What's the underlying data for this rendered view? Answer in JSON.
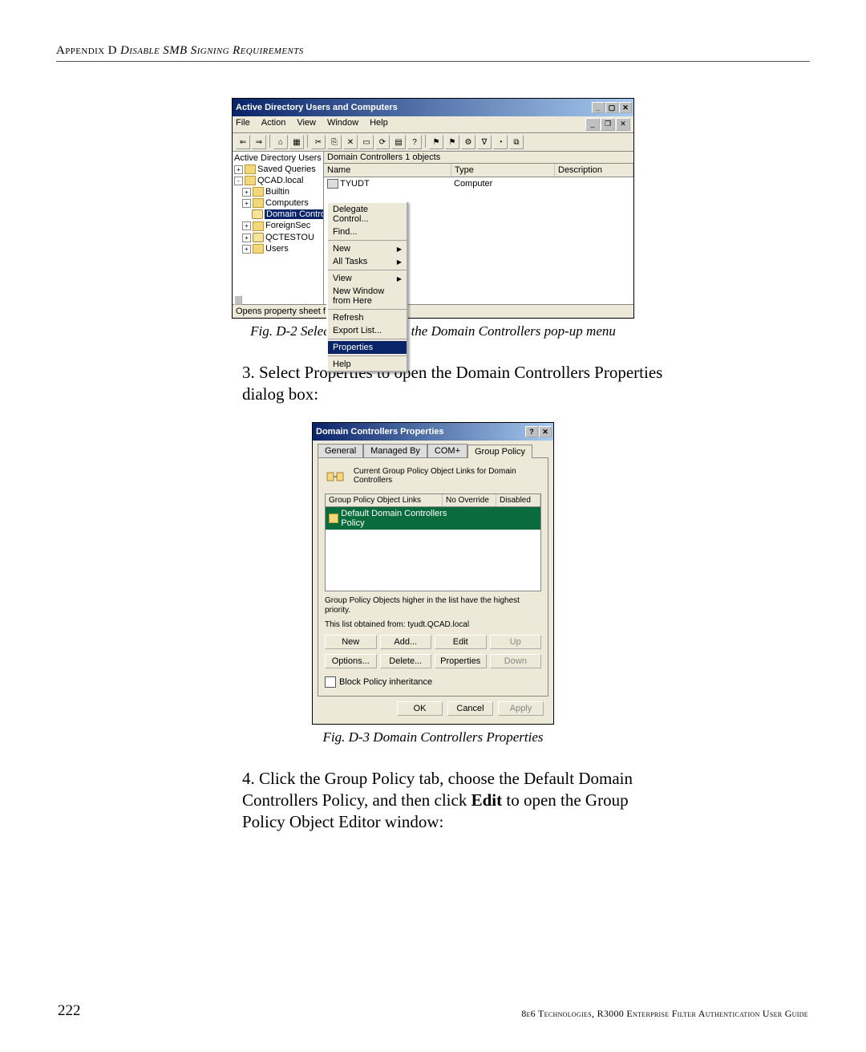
{
  "header": {
    "appendix": "Appendix D",
    "sep": "   ",
    "title_italic": "Disable SMB Signing Requirements"
  },
  "fig1": {
    "window_title": "Active Directory Users and Computers",
    "menus": [
      "File",
      "Action",
      "View",
      "Window",
      "Help"
    ],
    "toolbar_icons": [
      "⇐",
      "⇒",
      "⌂",
      "▦",
      "✂",
      "⎘",
      "✕",
      "▭",
      "⟳",
      "▤",
      "?",
      "⚑",
      "⚑",
      "⚙",
      "∇",
      "◔",
      "⧉"
    ],
    "tree_root": "Active Directory Users and Computers",
    "tree": [
      {
        "exp": "+",
        "label": "Saved Queries",
        "indent": 0,
        "icon": "folder"
      },
      {
        "exp": "-",
        "label": "QCAD.local",
        "indent": 0,
        "icon": "folder"
      },
      {
        "exp": "+",
        "label": "Builtin",
        "indent": 1,
        "icon": "folder"
      },
      {
        "exp": "+",
        "label": "Computers",
        "indent": 1,
        "icon": "folder"
      },
      {
        "exp": "",
        "label": "Domain Controllers",
        "indent": 1,
        "icon": "ou",
        "selected": true
      },
      {
        "exp": "+",
        "label": "ForeignSec",
        "indent": 1,
        "icon": "folder"
      },
      {
        "exp": "+",
        "label": "QCTESTOU",
        "indent": 1,
        "icon": "ou"
      },
      {
        "exp": "+",
        "label": "Users",
        "indent": 1,
        "icon": "folder"
      }
    ],
    "crumb": "Domain Controllers   1 objects",
    "columns": [
      "Name",
      "Type",
      "Description"
    ],
    "row_name": "TYUDT",
    "row_type": "Computer",
    "context_menu": [
      {
        "label": "Delegate Control..."
      },
      {
        "label": "Find..."
      },
      {
        "sep": true
      },
      {
        "label": "New",
        "sub": true
      },
      {
        "label": "All Tasks",
        "sub": true
      },
      {
        "sep": true
      },
      {
        "label": "View",
        "sub": true
      },
      {
        "label": "New Window from Here"
      },
      {
        "sep": true
      },
      {
        "label": "Refresh"
      },
      {
        "label": "Export List..."
      },
      {
        "sep": true
      },
      {
        "label": "Properties",
        "selected": true
      },
      {
        "sep": true
      },
      {
        "label": "Help"
      }
    ],
    "statusbar": "Opens property sheet f",
    "caption": "Fig. D-2  Select Properties in the Domain Controllers pop-up menu"
  },
  "step3": {
    "num": "3.",
    "text": "Select Properties to open the Domain Controllers Properties dialog box:"
  },
  "fig2": {
    "window_title": "Domain Controllers Properties",
    "tabs": [
      "General",
      "Managed By",
      "COM+",
      "Group Policy"
    ],
    "active_tab": 3,
    "panel_heading": "Current Group Policy Object Links for Domain Controllers",
    "table_headers": [
      "Group Policy Object Links",
      "No Override",
      "Disabled"
    ],
    "gpo_item": "Default Domain Controllers Policy",
    "help1": "Group Policy Objects higher in the list have the highest priority.",
    "help2": "This list obtained from: tyudt.QCAD.local",
    "buttons_row1": [
      "New",
      "Add...",
      "Edit",
      "Up"
    ],
    "buttons_row2": [
      "Options...",
      "Delete...",
      "Properties",
      "Down"
    ],
    "disabled_btns": [
      "Up",
      "Down"
    ],
    "checkbox_label": "Block Policy inheritance",
    "footer_btns": [
      "OK",
      "Cancel",
      "Apply"
    ],
    "caption": "Fig. D-3  Domain Controllers Properties"
  },
  "step4": {
    "num": "4.",
    "text_a": "Click the Group Policy tab, choose the Default Domain Controllers Policy, and then click ",
    "text_bold": "Edit",
    "text_b": " to open the Group Policy Object Editor window:"
  },
  "footer": {
    "page": "222",
    "right": "8e6 Technologies, R3000 Enterprise Filter Authentication User Guide"
  }
}
